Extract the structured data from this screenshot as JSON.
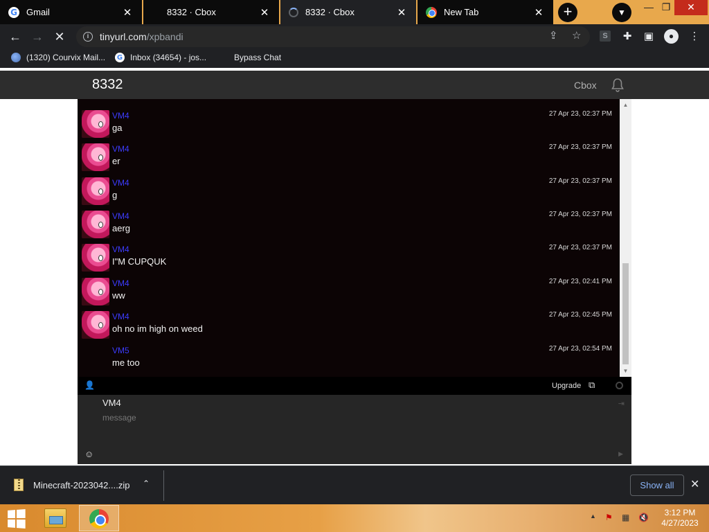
{
  "browser": {
    "tabs": [
      {
        "title": "Gmail",
        "icon": "google-icon",
        "state": "inactive"
      },
      {
        "title": "8332 · Cbox",
        "icon": "none",
        "state": "inactive"
      },
      {
        "title": "8332 · Cbox",
        "icon": "loading-spinner",
        "state": "active"
      },
      {
        "title": "New Tab",
        "icon": "chrome-icon",
        "state": "inactive"
      }
    ],
    "url_host": "tinyurl.com",
    "url_path": "/xpbandi",
    "bookmarks": [
      {
        "label": "(1320) Courvix Mail...",
        "icon": "globe-icon"
      },
      {
        "label": "Inbox (34654) - jos...",
        "icon": "google-icon"
      },
      {
        "label": "Bypass Chat",
        "icon": "none"
      }
    ]
  },
  "cbox": {
    "title": "8332",
    "link_label": "Cbox",
    "messages": [
      {
        "user": "VM4",
        "text": "ga",
        "time": "27 Apr 23, 02:37 PM",
        "avatar": "pony"
      },
      {
        "user": "VM4",
        "text": "er",
        "time": "27 Apr 23, 02:37 PM",
        "avatar": "pony"
      },
      {
        "user": "VM4",
        "text": "g",
        "time": "27 Apr 23, 02:37 PM",
        "avatar": "pony"
      },
      {
        "user": "VM4",
        "text": "aerg",
        "time": "27 Apr 23, 02:37 PM",
        "avatar": "pony"
      },
      {
        "user": "VM4",
        "text": "I\"M CUPQUK",
        "time": "27 Apr 23, 02:37 PM",
        "avatar": "pony"
      },
      {
        "user": "VM4",
        "text": "ww",
        "time": "27 Apr 23, 02:41 PM",
        "avatar": "pony"
      },
      {
        "user": "VM4",
        "text": "oh no im high on weed",
        "time": "27 Apr 23, 02:45 PM",
        "avatar": "pony"
      },
      {
        "user": "VM5",
        "text": "me too",
        "time": "27 Apr 23, 02:54 PM",
        "avatar": "none"
      }
    ],
    "upgrade_label": "Upgrade",
    "input_name": "VM4",
    "input_placeholder": "message"
  },
  "downloads": {
    "file": "Minecraft-2023042....zip",
    "show_all": "Show all"
  },
  "taskbar": {
    "time": "3:12 PM",
    "date": "4/27/2023"
  },
  "colors": {
    "username": "#3c3cff",
    "chat_bg": "#0c0405",
    "accent_link": "#8ab4f8"
  }
}
